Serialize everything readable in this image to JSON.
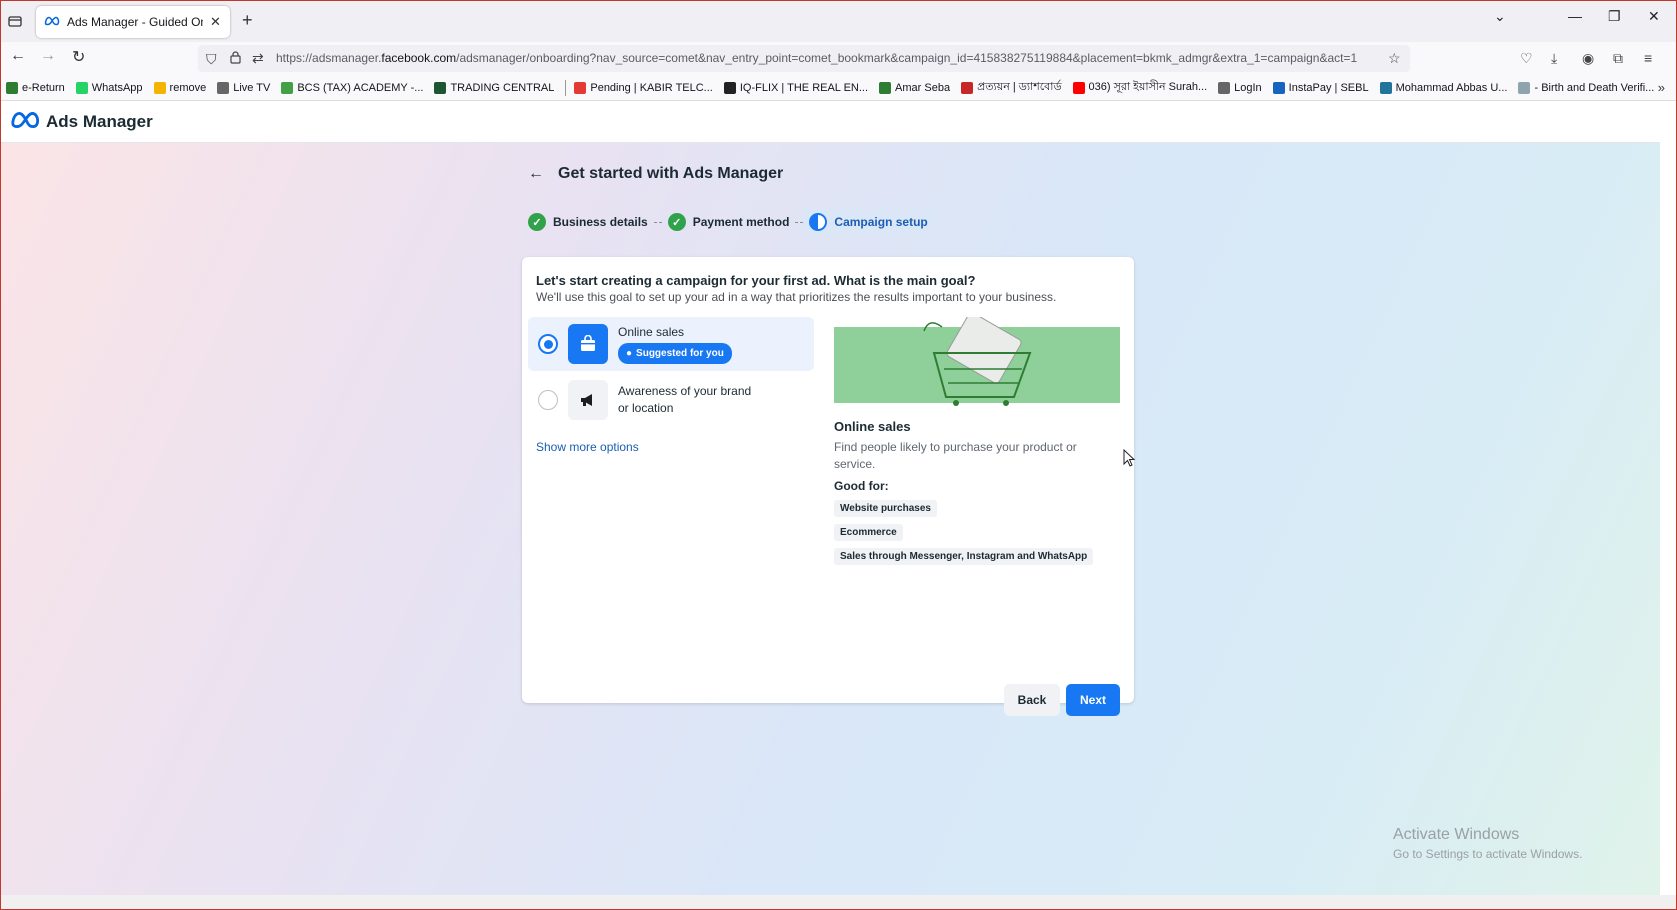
{
  "browser": {
    "tab_title": "Ads Manager - Guided Onboarding",
    "url_prefix": "https://adsmanager.",
    "url_domain": "facebook.com",
    "url_rest": "/adsmanager/onboarding?nav_source=comet&nav_entry_point=comet_bookmark&campaign_id=415838275119884&placement=bkmk_admgr&extra_1=campaign&act=1",
    "bookmarks": [
      {
        "label": "e-Return",
        "color": "#2e7d32"
      },
      {
        "label": "WhatsApp",
        "color": "#25d366"
      },
      {
        "label": "remove",
        "color": "#f4b400"
      },
      {
        "label": "Live TV",
        "color": "#666666"
      },
      {
        "label": "BCS (TAX) ACADEMY -...",
        "color": "#43a047"
      },
      {
        "label": "TRADING CENTRAL",
        "color": "#1e5631"
      },
      {
        "label": "Pending | KABIR TELC...",
        "color": "#e53935"
      },
      {
        "label": "IQ-FLIX | THE REAL EN...",
        "color": "#222222"
      },
      {
        "label": "Amar Seba",
        "color": "#2e7d32"
      },
      {
        "label": "প্রত্যয়ন | ড্যাশবোর্ড",
        "color": "#c62828"
      },
      {
        "label": "036) সূরা ইয়াসীন Surah...",
        "color": "#ff0000"
      },
      {
        "label": "LogIn",
        "color": "#666666"
      },
      {
        "label": "InstaPay | SEBL",
        "color": "#1565c0"
      },
      {
        "label": "Mohammad Abbas U...",
        "color": "#21759b"
      },
      {
        "label": "- Birth and Death Verifi...",
        "color": "#90a4ae"
      }
    ]
  },
  "app": {
    "brand": "Ads Manager"
  },
  "onboarding": {
    "heading": "Get started with Ads Manager",
    "steps": [
      {
        "label": "Business details",
        "state": "done"
      },
      {
        "label": "Payment method",
        "state": "done"
      },
      {
        "label": "Campaign setup",
        "state": "active"
      }
    ],
    "question": "Let's start creating a campaign for your first ad. What is the main goal?",
    "subtext": "We'll use this goal to set up your ad in a way that prioritizes the results important to your business.",
    "options": [
      {
        "label": "Online sales",
        "badge": "Suggested for you",
        "selected": true
      },
      {
        "label": "Awareness of your brand or location",
        "selected": false
      }
    ],
    "show_more": "Show more options",
    "detail": {
      "title": "Online sales",
      "description": "Find people likely to purchase your product or service.",
      "good_for_label": "Good for:",
      "good_for": [
        "Website purchases",
        "Ecommerce",
        "Sales through Messenger, Instagram and WhatsApp"
      ]
    },
    "back_label": "Back",
    "next_label": "Next"
  },
  "windows_watermark": {
    "line1": "Activate Windows",
    "line2": "Go to Settings to activate Windows."
  },
  "colors": {
    "primary": "#1877f2",
    "success": "#31a24c",
    "illustration_green": "#8fcf9a"
  }
}
